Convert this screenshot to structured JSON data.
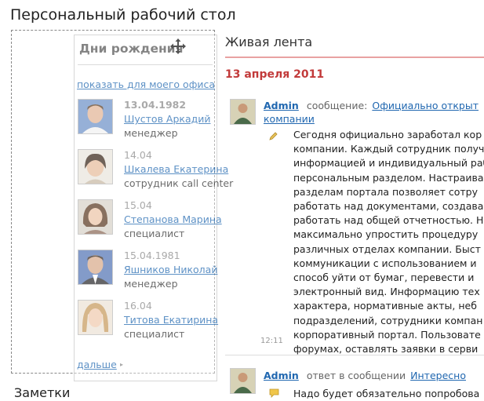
{
  "page": {
    "title": "Персональный рабочий стол"
  },
  "bottom_widget": {
    "title": "Заметки"
  },
  "feed": {
    "title": "Живая лента",
    "date": "13 апреля 2011",
    "posts": [
      {
        "author": "Admin",
        "action": "сообщение:",
        "link_line1": "Официально открыт",
        "link_line2": "компании",
        "text_lines": [
          "Сегодня официально заработал кор",
          "компании. Каждый сотрудник получ",
          "информацией и индивидуальный раб",
          "персональным разделом. Настраива",
          "разделам портала позволяет сотру",
          "работать над документами, создава",
          "работать над общей отчетностью. Н",
          "максимально упростить процедуру",
          "различных отделах компании. Быст",
          "коммуникации с использованием и",
          "способ уйти от бумаг, перевести и",
          "электронный вид. Информацию тех",
          "характера, нормативные акты, неб",
          "подразделений, сотрудники компан",
          "корпоративный портал. Пользовате",
          "форумах, оставлять заявки в серви"
        ],
        "time": "12:11"
      },
      {
        "author": "Admin",
        "action": "ответ в сообщении",
        "link": "Интересно",
        "text_line": "Надо будет обязательно попробова"
      }
    ]
  },
  "birthdays": {
    "title": "Дни рождения",
    "office_link": "показать для моего офиса",
    "items": [
      {
        "date": "13.04.1982",
        "name": "Шустов Аркадий",
        "position": "менеджер",
        "bold": true
      },
      {
        "date": "14.04",
        "name": "Шкалева Екатерина",
        "position": "сотрудник call center",
        "bold": false
      },
      {
        "date": "15.04",
        "name": "Степанова Марина",
        "position": "специалист",
        "bold": false
      },
      {
        "date": "15.04.1981",
        "name": "Яшников Николай",
        "position": "менеджер",
        "bold": false
      },
      {
        "date": "16.04",
        "name": "Титова Екатирина",
        "position": "специалист",
        "bold": false
      }
    ],
    "more_link": "дальше",
    "more_arrow": "▸"
  },
  "icons": [
    "move-icon",
    "pencil-icon",
    "comment-icon"
  ]
}
